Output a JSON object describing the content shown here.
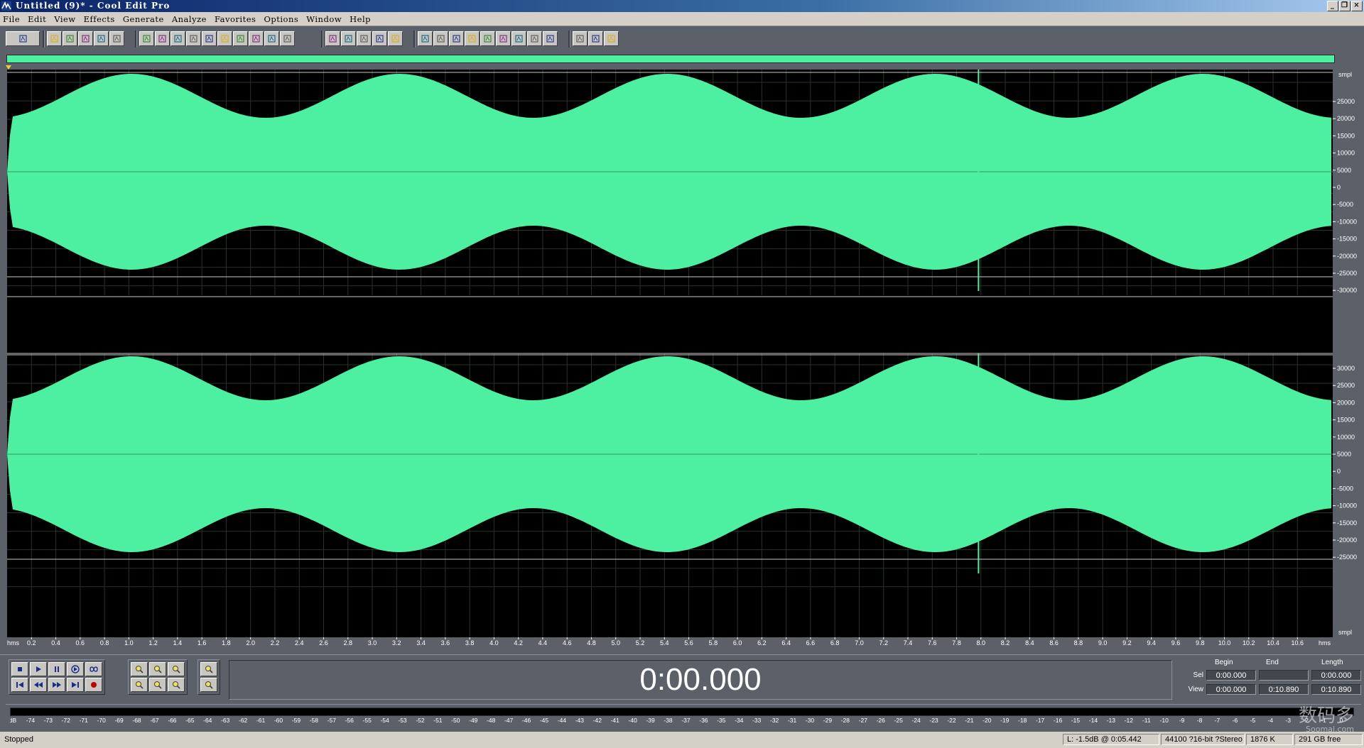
{
  "window": {
    "title": "Untitled (9)* - Cool Edit Pro",
    "app_icon": "cool-edit-app-icon",
    "controls": [
      "_",
      "❐",
      "×"
    ]
  },
  "menu": [
    "File",
    "Edit",
    "View",
    "Effects",
    "Generate",
    "Analyze",
    "Favorites",
    "Options",
    "Window",
    "Help"
  ],
  "toolbar": {
    "groups": [
      [
        "multitrack-toggle-icon"
      ],
      [
        "new-file-icon",
        "open-file-icon",
        "save-icon",
        "save-as-icon",
        "save-selection-icon"
      ],
      [
        "undo-icon",
        "redo-icon",
        "repeat-icon",
        "copy-new-icon",
        "cut-icon",
        "copy-icon",
        "paste-icon",
        "paste-new-icon",
        "mix-paste-icon",
        "trim-icon"
      ],
      [
        "envelope-icon",
        "snap-icon",
        "spectral-view-icon",
        "waveform-view-icon",
        "grid-icon"
      ],
      [
        "cue-list-icon",
        "play-list-icon",
        "info-icon",
        "script-icon",
        "zoom-icon",
        "time-format-icon",
        "bars-beats-icon",
        "frequency-analysis-icon",
        "mixer-icon"
      ],
      [
        "settings-icon",
        "wizard-icon",
        "help-icon"
      ]
    ]
  },
  "waveform": {
    "fill_color": "#4cf0a0",
    "background": "#000000",
    "channels": 2,
    "duration_seconds": 10.89,
    "y_unit": "smpl",
    "y_ticks": [
      "25000",
      "20000",
      "15000",
      "10000",
      "5000",
      "0",
      "-5000",
      "-10000",
      "-15000",
      "-20000",
      "-25000",
      "-30000"
    ],
    "y_ticks_lower": [
      "30000",
      "25000",
      "20000",
      "15000",
      "10000",
      "5000",
      "0",
      "-5000",
      "-10000",
      "-15000",
      "-20000",
      "-25000"
    ],
    "x_unit": "hms",
    "x_ticks": [
      "0.2",
      "0.4",
      "0.6",
      "0.8",
      "1.0",
      "1.2",
      "1.4",
      "1.6",
      "1.8",
      "2.0",
      "2.2",
      "2.4",
      "2.6",
      "2.8",
      "3.0",
      "3.2",
      "3.4",
      "3.6",
      "3.8",
      "4.0",
      "4.2",
      "4.4",
      "4.6",
      "4.8",
      "5.0",
      "5.2",
      "5.4",
      "5.6",
      "5.8",
      "6.0",
      "6.2",
      "6.4",
      "6.6",
      "6.8",
      "7.0",
      "7.2",
      "7.4",
      "7.6",
      "7.8",
      "8.0",
      "8.2",
      "8.4",
      "8.6",
      "8.8",
      "9.0",
      "9.2",
      "9.4",
      "9.6",
      "9.8",
      "10.0",
      "10.2",
      "10.4",
      "10.6"
    ]
  },
  "transport": {
    "row1": [
      "stop-icon",
      "play-icon",
      "pause-icon",
      "play-to-end-icon",
      "loop-icon"
    ],
    "row2": [
      "go-to-start-icon",
      "rewind-icon",
      "fast-forward-icon",
      "go-to-end-icon",
      "record-icon"
    ],
    "zoom_row1": [
      "zoom-in-horizontal-icon",
      "zoom-out-horizontal-icon",
      "zoom-full-icon"
    ],
    "zoom_row2": [
      "zoom-to-left-icon",
      "zoom-to-right-icon",
      "zoom-selection-icon"
    ],
    "zoom_v": [
      "zoom-in-vertical-icon",
      "zoom-out-vertical-icon"
    ],
    "time": "0:00.000"
  },
  "selection": {
    "headers": {
      "begin": "Begin",
      "end": "End",
      "length": "Length"
    },
    "sel_label": "Sel",
    "view_label": "View",
    "sel": {
      "begin": "0:00.000",
      "end": "",
      "length": "0:00.000"
    },
    "view": {
      "begin": "0:00.000",
      "end": "0:10.890",
      "length": "0:10.890"
    }
  },
  "meter": {
    "ticks": [
      "dB",
      "-74",
      "-73",
      "-72",
      "-71",
      "-70",
      "-69",
      "-68",
      "-67",
      "-66",
      "-65",
      "-64",
      "-63",
      "-62",
      "-61",
      "-60",
      "-59",
      "-58",
      "-57",
      "-56",
      "-55",
      "-54",
      "-53",
      "-52",
      "-51",
      "-50",
      "-49",
      "-48",
      "-47",
      "-46",
      "-45",
      "-44",
      "-43",
      "-42",
      "-41",
      "-40",
      "-39",
      "-38",
      "-37",
      "-36",
      "-35",
      "-34",
      "-33",
      "-32",
      "-31",
      "-30",
      "-29",
      "-28",
      "-27",
      "-26",
      "-25",
      "-24",
      "-23",
      "-22",
      "-21",
      "-20",
      "-19",
      "-18",
      "-17",
      "-16",
      "-15",
      "-14",
      "-13",
      "-12",
      "-11",
      "-10",
      "-9",
      "-8",
      "-7",
      "-6",
      "-5",
      "-4",
      "-3",
      "-2",
      "-1",
      "0"
    ]
  },
  "status": {
    "state": "Stopped",
    "level": "L: -1.5dB @  0:05.442",
    "format": "44100 ?16-bit ?Stereo",
    "size": "1876 K",
    "free": "291 GB free"
  },
  "watermark": {
    "text": "数码多",
    "sub": "Soomal.com"
  }
}
